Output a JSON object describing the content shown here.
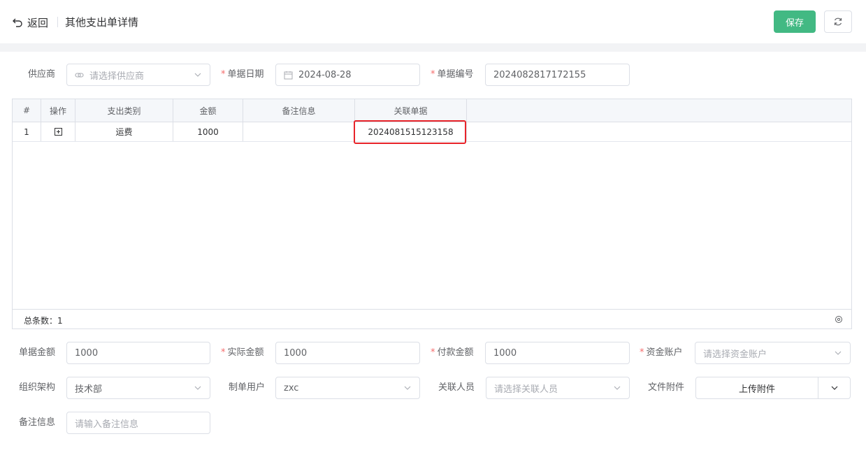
{
  "header": {
    "back_label": "返回",
    "title": "其他支出单详情",
    "save_label": "保存"
  },
  "form_top": {
    "supplier": {
      "label": "供应商",
      "placeholder": "请选择供应商"
    },
    "doc_date": {
      "label": "单据日期",
      "value": "2024-08-28"
    },
    "doc_no": {
      "label": "单据编号",
      "value": "2024082817172155"
    }
  },
  "table": {
    "columns": [
      "#",
      "操作",
      "支出类别",
      "金额",
      "备注信息",
      "关联单据"
    ],
    "rows": [
      {
        "index": "1",
        "category": "运费",
        "amount": "1000",
        "remark": "",
        "related_doc": "2024081515123158"
      }
    ],
    "total_label": "总条数：1"
  },
  "form_bottom": {
    "doc_amount": {
      "label": "单据金额",
      "value": "1000"
    },
    "actual_amount": {
      "label": "实际金额",
      "value": "1000"
    },
    "pay_amount": {
      "label": "付款金额",
      "value": "1000"
    },
    "fund_account": {
      "label": "资金账户",
      "placeholder": "请选择资金账户"
    },
    "org": {
      "label": "组织架构",
      "value": "技术部"
    },
    "creator": {
      "label": "制单用户",
      "value": "zxc"
    },
    "related_person": {
      "label": "关联人员",
      "placeholder": "请选择关联人员"
    },
    "attachment": {
      "label": "文件附件",
      "button": "上传附件"
    },
    "remark": {
      "label": "备注信息",
      "placeholder": "请输入备注信息"
    }
  },
  "colors": {
    "accent": "#42b983",
    "highlight": "#e8242a",
    "required": "#f56c6c"
  }
}
